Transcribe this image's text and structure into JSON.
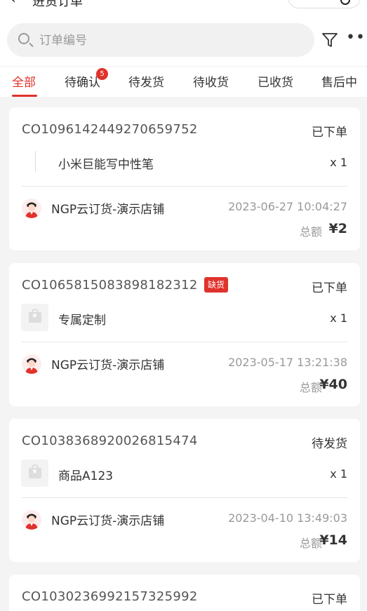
{
  "header": {
    "title": "进货订单"
  },
  "search": {
    "placeholder": "订单编号"
  },
  "tabs": [
    {
      "label": "全部",
      "active": true
    },
    {
      "label": "待确认",
      "badge": "5"
    },
    {
      "label": "待发货"
    },
    {
      "label": "待收货"
    },
    {
      "label": "已收货"
    },
    {
      "label": "售后中"
    }
  ],
  "orders": [
    {
      "order_no": "CO1096142449270659752",
      "status": "已下单",
      "product": "小米巨能写中性笔",
      "qty": "x 1",
      "shop": "NGP云订货-演示店铺",
      "time": "2023-06-27 10:04:27",
      "total_label": "总额",
      "amount": "¥2"
    },
    {
      "order_no": "CO1065815083898182312",
      "tag": "缺货",
      "status": "已下单",
      "product": "专属定制",
      "qty": "x 1",
      "shop": "NGP云订货-演示店铺",
      "time": "2023-05-17 13:21:38",
      "total_label": "总额",
      "amount": "¥40"
    },
    {
      "order_no": "CO1038368920026815474",
      "status": "待发货",
      "product": "商品A123",
      "qty": "x 1",
      "shop": "NGP云订货-演示店铺",
      "time": "2023-04-10 13:49:03",
      "total_label": "总额",
      "amount": "¥14"
    },
    {
      "order_no": "CO1030236992157325992",
      "status": "已下单"
    }
  ],
  "icons": {
    "search": "search-icon",
    "filter": "filter-icon",
    "more": "more-icon",
    "back": "back-icon",
    "avatar": "avatar",
    "product": "product-placeholder-icon"
  },
  "colors": {
    "accent": "#e0322b"
  }
}
